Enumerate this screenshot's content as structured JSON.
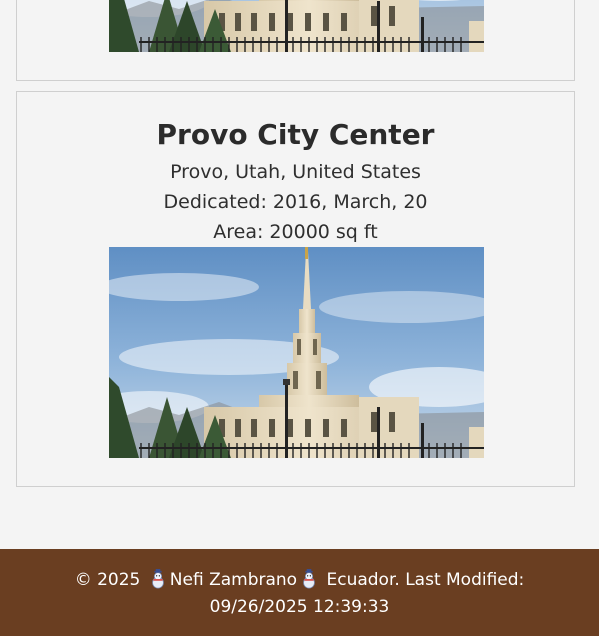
{
  "temples": [
    {
      "image_alt": "Temple photo"
    },
    {
      "name": "Provo City Center",
      "location": "Provo, Utah, United States",
      "dedicated": "Dedicated: 2016, March, 20",
      "area": "Area: 20000 sq ft",
      "image_alt": "Provo City Center temple photo"
    }
  ],
  "footer": {
    "copyright": "© 2025",
    "author": "Nefi Zambrano",
    "country": "Ecuador.",
    "last_modified": "Last Modified: 09/26/2025 12:39:33",
    "icon": "snowman-icon"
  },
  "colors": {
    "footer_bg": "#6a3e21",
    "page_bg": "#f4f4f4",
    "card_border": "#cfcfcf"
  }
}
